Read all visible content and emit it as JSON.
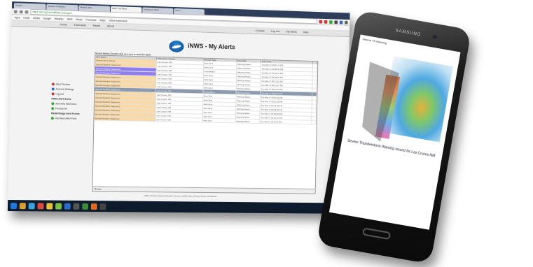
{
  "browser": {
    "tabs": [
      "Google - ...",
      "Weather Prediction",
      "Multiple Tabs ...",
      "NWS - My Alerts",
      "Hazardous Weat...",
      "Inbox - ..."
    ],
    "url": "https://ari.ncgl.mat.affiliate.noaa.gov/...",
    "bookmarks": [
      "Apps",
      "Email",
      "NOAA",
      "Google",
      "Weather",
      "NWS",
      "Radar",
      "Forecasts",
      "Maps",
      "Other bookmarks"
    ]
  },
  "site_nav": {
    "left": [
      "Home",
      "Forecasts",
      "Radar",
      "About"
    ],
    "right": [
      "Contact",
      "Log out",
      "My Alerts",
      "Help"
    ]
  },
  "page": {
    "title": "iNWS - My Alerts",
    "table_caption": "Recent Alerts (Double click on a row to view the alert)",
    "table_footer": "15 rows",
    "footer": "NWS | NOAA | National Weather Service | iNWS Help | Privacy Policy | Disclaimer"
  },
  "sidebar": {
    "items": [
      "Alert Preview",
      "Account Settings",
      "Log out"
    ],
    "section1": "iNWS Alert Areas",
    "section1_items": [
      "Add New Alert Area",
      "Preview All"
    ],
    "section2": "Radar/Image Alert Points",
    "section2_items": [
      "Add New Alert Point"
    ]
  },
  "table": {
    "columns": [
      "Alert Event",
      "Office Area / Station",
      "Product Type",
      "Issued By",
      "Issue Time",
      ""
    ],
    "rows": [
      {
        "event": "Severe Storm Ahead",
        "area": "Las Cruces, NM",
        "type": "Alert Sent",
        "issued": "Warning Aware",
        "time": "Tue Mar 17 06:57:14 PM",
        "style": "r-tan"
      },
      {
        "event": "Special Weather Statement",
        "area": "Las Cruces, NM",
        "type": "Alert Sent",
        "issued": "Warning Aware",
        "time": "Tue Mar 17 06:49:02 PM",
        "style": "r-tan"
      },
      {
        "event": "Special Weather Statement",
        "area": "Las Cruces, NM",
        "type": "Cancellation",
        "issued": "Warning Aware",
        "time": "Tue Mar 17 06:42:31 PM",
        "style": "r-blue"
      },
      {
        "event": "Special Weather Statement",
        "area": "Las Cruces, NM",
        "type": "Alert Sent",
        "issued": "Warning Aware",
        "time": "Tue Mar 17 06:38:55 PM",
        "style": "r-blue"
      },
      {
        "event": "Special Weather Statement",
        "area": "Las Cruces, NM",
        "type": "Alert Sent",
        "issued": "Warning Aware",
        "time": "Tue Mar 17 06:31:10 PM",
        "style": "r-tan"
      },
      {
        "event": "Special Weather Statement",
        "area": "Las Cruces, NM",
        "type": "Alert Sent",
        "issued": "Warning Aware",
        "time": "Tue Mar 17 06:22:47 PM",
        "style": "r-tan"
      },
      {
        "event": "Special Weather Statement",
        "area": "Las Cruces, NM",
        "type": "Alert Sent",
        "issued": "Warning Aware",
        "time": "Tue Mar 17 06:15:03 PM",
        "style": "r-tan"
      },
      {
        "event": "Special Weather Statement",
        "area": "Las Cruces, NM",
        "type": "Cancellation",
        "issued": "Warning Aware",
        "time": "Tue Mar 17 06:08:40 PM",
        "style": "r-gray"
      },
      {
        "event": "Special Weather Statement",
        "area": "Las Cruces, NM",
        "type": "Alert Sent",
        "issued": "Warning Aware",
        "time": "Tue Mar 17 05:59:12 PM",
        "style": "r-tan"
      },
      {
        "event": "Special Weather Statement",
        "area": "Las Cruces, NM",
        "type": "Alert Sent",
        "issued": "Warning Aware",
        "time": "Tue Mar 17 05:51:26 PM",
        "style": "r-tan"
      },
      {
        "event": "Special Weather Statement",
        "area": "Las Cruces, NM",
        "type": "Alert Sent",
        "issued": "Warning Aware",
        "time": "Tue Mar 17 05:44:09 PM",
        "style": "r-tan"
      },
      {
        "event": "Special Weather Statement",
        "area": "Las Cruces, NM",
        "type": "Alert Sent",
        "issued": "Warning Aware",
        "time": "Tue Mar 17 05:36:58 PM",
        "style": "r-tan"
      },
      {
        "event": "Special Weather Statement",
        "area": "Las Cruces, NM",
        "type": "Alert Sent",
        "issued": "Warning Aware",
        "time": "Tue Mar 17 05:28:33 PM",
        "style": "r-tan"
      },
      {
        "event": "Special Weather Statement",
        "area": "Las Cruces, NM",
        "type": "Alert Sent",
        "issued": "Warning Aware",
        "time": "Tue Mar 17 05:20:17 PM",
        "style": "r-tan"
      },
      {
        "event": "Special Weather Statement",
        "area": "Las Cruces, NM",
        "type": "Alert Sent",
        "issued": "Warning Aware",
        "time": "Tue Mar 17 05:12:44 PM",
        "style": "r-tan"
      }
    ]
  },
  "taskbar": {
    "clock": "6:58 PM"
  },
  "phone": {
    "brand": "SAMSUNG",
    "caption": "Severe TS Warning",
    "text": "Severe Thunderstorm Warning issued for Las Cruces NM"
  },
  "colors": {
    "accent_tan": "#f9d9a6",
    "accent_purple": "#8e7df0",
    "accent_gray": "#8a99ae",
    "taskbar": "#0d1b2c"
  }
}
